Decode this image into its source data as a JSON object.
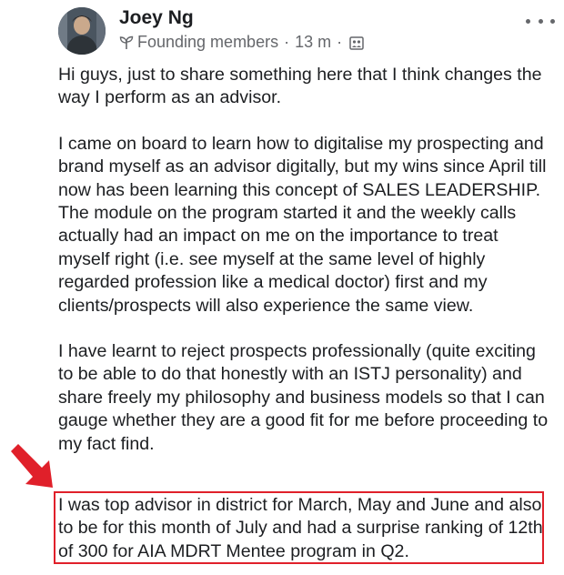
{
  "post": {
    "author": "Joey Ng",
    "group": "Founding members",
    "time": "13 m",
    "separator": "·",
    "group_icon": "group-photo-icon",
    "badge_icon": "sprout-icon",
    "more_icon": "more-options-icon",
    "paragraphs": [
      "Hi guys, just to share something here that I think changes the way I perform as an advisor.",
      "I came on board to learn how to digitalise my prospecting and brand myself as an advisor digitally, but my wins since April till now has been learning this concept of SALES LEADERSHIP. The module on the program started it and the weekly calls actually had an impact on me on the importance to treat myself right (i.e. see myself at the same level of highly regarded profession like a medical doctor) first and my clients/prospects will also experience the same view.",
      "I have learnt to reject prospects professionally (quite exciting to be able to do that honestly with an ISTJ personality) and share freely my philosophy and business models so that I can gauge whether they are a good fit for me before proceeding to my fact find."
    ],
    "highlighted_paragraph": "I was top advisor in district for March, May and June and also to be for this month of July and had a surprise ranking of 12th of 300 for AIA MDRT Mentee program in Q2."
  },
  "annotation": {
    "arrow_color": "#e0202a",
    "box_color": "#e0202a"
  }
}
